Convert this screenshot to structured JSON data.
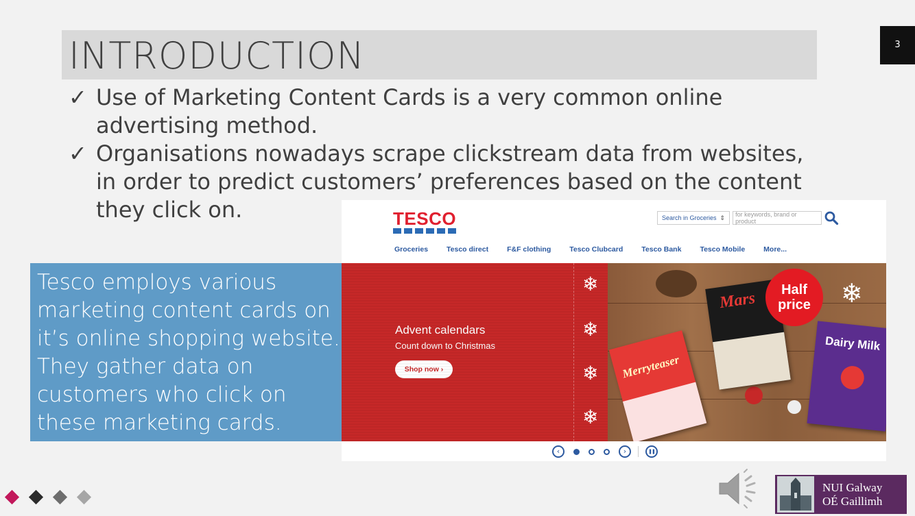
{
  "slide": {
    "title": "INTRODUCTION",
    "page_number": "3",
    "bullets": [
      {
        "check": "✓",
        "text": "Use of Marketing Content Cards is a very common online advertising method."
      },
      {
        "check": "✓",
        "text": "Organisations nowadays scrape clickstream data from websites, in order to predict customers’ preferences based on the content they click on."
      }
    ],
    "callout": "Tesco employs various marketing content cards on it’s online shopping website. They gather data on customers who click on these marketing cards.",
    "accent_colors": [
      "#c2185b",
      "#2b2b2b",
      "#6d6d6d",
      "#a6a6a6"
    ]
  },
  "tesco": {
    "logo": "TESCO",
    "search_scope": "Search in Groceries",
    "search_scope_arrow": "⇕",
    "search_placeholder": "for keywords, brand or product",
    "nav": [
      "Groceries",
      "Tesco direct",
      "F&F clothing",
      "Tesco Clubcard",
      "Tesco Bank",
      "Tesco Mobile",
      "More..."
    ],
    "banner": {
      "title": "Advent calendars",
      "subtitle": "Count down to Christmas",
      "button": "Shop now ›",
      "badge_line1": "Half",
      "badge_line2": "price",
      "card_merryteaser": "Merryteaser",
      "card_mars": "Mars",
      "card_dairymilk": "Dairy Milk"
    },
    "carousel": {
      "prev": "‹",
      "next": "›",
      "pause": "❚❚"
    }
  },
  "logo": {
    "line1": "NUI Galway",
    "line2": "OÉ Gaillimh"
  },
  "colors": {
    "brand_red": "#e0202f",
    "tesco_blue": "#2d5aa0",
    "callout_blue": "#5f9bc7",
    "nui_purple": "#5b2a60"
  }
}
